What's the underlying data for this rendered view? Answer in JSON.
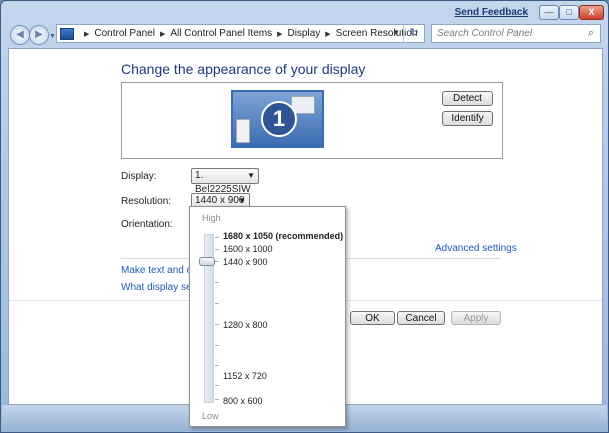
{
  "titlebar": {
    "feedback_label": "Send Feedback",
    "min_glyph": "—",
    "max_glyph": "□",
    "close_glyph": "X"
  },
  "navbar": {
    "back_glyph": "◀",
    "forward_glyph": "▶",
    "dropdown_glyph": "▼",
    "breadcrumb": [
      "Control Panel",
      "All Control Panel Items",
      "Display",
      "Screen Resolution"
    ],
    "separator_glyph": "▶",
    "address_dropdown_glyph": "▼",
    "refresh_glyph": "↻",
    "search_placeholder": "Search Control Panel",
    "search_glyph": "⌕"
  },
  "main": {
    "heading": "Change the appearance of your display",
    "monitor_number": "1",
    "detect_label": "Detect",
    "identify_label": "Identify",
    "display_label": "Display:",
    "display_value": "1. Bel2225SIW",
    "resolution_label": "Resolution:",
    "resolution_value": "1440 x 900",
    "orientation_label": "Orientation:",
    "combo_arrow": "▼",
    "advanced_settings": "Advanced settings",
    "link_text_size": "Make text and other",
    "link_display_settings": "What display setting",
    "ok_label": "OK",
    "cancel_label": "Cancel",
    "apply_label": "Apply"
  },
  "resolution_dropdown": {
    "high_label": "High",
    "low_label": "Low",
    "options": [
      "1680 x 1050 (recommended)",
      "1600 x 1000",
      "1440 x 900",
      "1280 x 800",
      "1152 x 720",
      "800 x 600"
    ],
    "selected": "1440 x 900"
  }
}
